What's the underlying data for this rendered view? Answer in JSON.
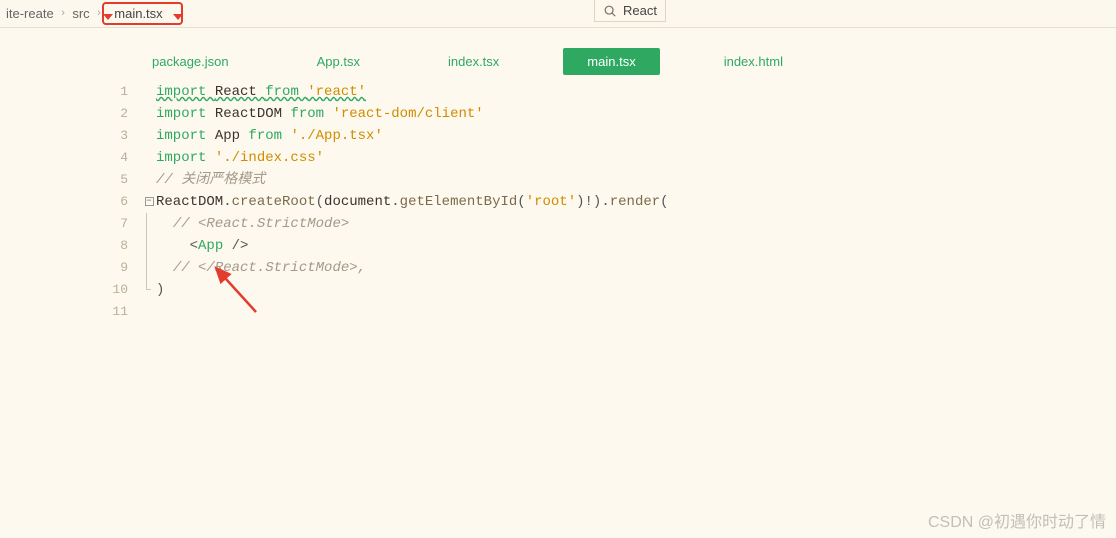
{
  "breadcrumb": {
    "items": [
      "ite-reate",
      "src",
      "main.tsx"
    ]
  },
  "react_badge": "React",
  "tabs": [
    {
      "label": "package.json",
      "active": false
    },
    {
      "label": "App.tsx",
      "active": false
    },
    {
      "label": "index.tsx",
      "active": false
    },
    {
      "label": "main.tsx",
      "active": true
    },
    {
      "label": "index.html",
      "active": false
    }
  ],
  "code": {
    "lines": [
      {
        "n": 1,
        "t": [
          [
            "kw squig",
            "import "
          ],
          [
            "ident squig",
            "React "
          ],
          [
            "kw squig",
            "from "
          ],
          [
            "str squig",
            "'react'"
          ]
        ]
      },
      {
        "n": 2,
        "t": [
          [
            "kw",
            "import "
          ],
          [
            "ident",
            "ReactDOM "
          ],
          [
            "kw",
            "from "
          ],
          [
            "str",
            "'react-dom/client'"
          ]
        ]
      },
      {
        "n": 3,
        "t": [
          [
            "kw",
            "import "
          ],
          [
            "ident",
            "App "
          ],
          [
            "kw",
            "from "
          ],
          [
            "str",
            "'./App.tsx'"
          ]
        ]
      },
      {
        "n": 4,
        "t": [
          [
            "kw",
            "import "
          ],
          [
            "str",
            "'./index.css'"
          ]
        ]
      },
      {
        "n": 5,
        "t": [
          [
            "comment",
            "// 关闭严格模式"
          ]
        ]
      },
      {
        "n": 6,
        "fold": true,
        "t": [
          [
            "ident",
            "ReactDOM"
          ],
          [
            "punct",
            "."
          ],
          [
            "func",
            "createRoot"
          ],
          [
            "punct",
            "("
          ],
          [
            "ident",
            "document"
          ],
          [
            "punct",
            "."
          ],
          [
            "func",
            "getElementById"
          ],
          [
            "punct",
            "("
          ],
          [
            "str",
            "'root'"
          ],
          [
            "punct",
            ")!)"
          ],
          [
            "punct",
            "."
          ],
          [
            "func",
            "render"
          ],
          [
            "punct",
            "("
          ]
        ]
      },
      {
        "n": 7,
        "indent": 1,
        "t": [
          [
            "comment",
            "// <React.StrictMode>"
          ]
        ]
      },
      {
        "n": 8,
        "indent": 2,
        "t": [
          [
            "punct",
            "<"
          ],
          [
            "kw",
            "App"
          ],
          [
            "punct",
            " />"
          ]
        ]
      },
      {
        "n": 9,
        "indent": 1,
        "t": [
          [
            "comment",
            "// </React.StrictMode>,"
          ]
        ]
      },
      {
        "n": 10,
        "foldend": true,
        "t": [
          [
            "punct",
            ")"
          ]
        ]
      },
      {
        "n": 11,
        "t": []
      }
    ]
  },
  "watermark": "CSDN @初遇你时动了情"
}
